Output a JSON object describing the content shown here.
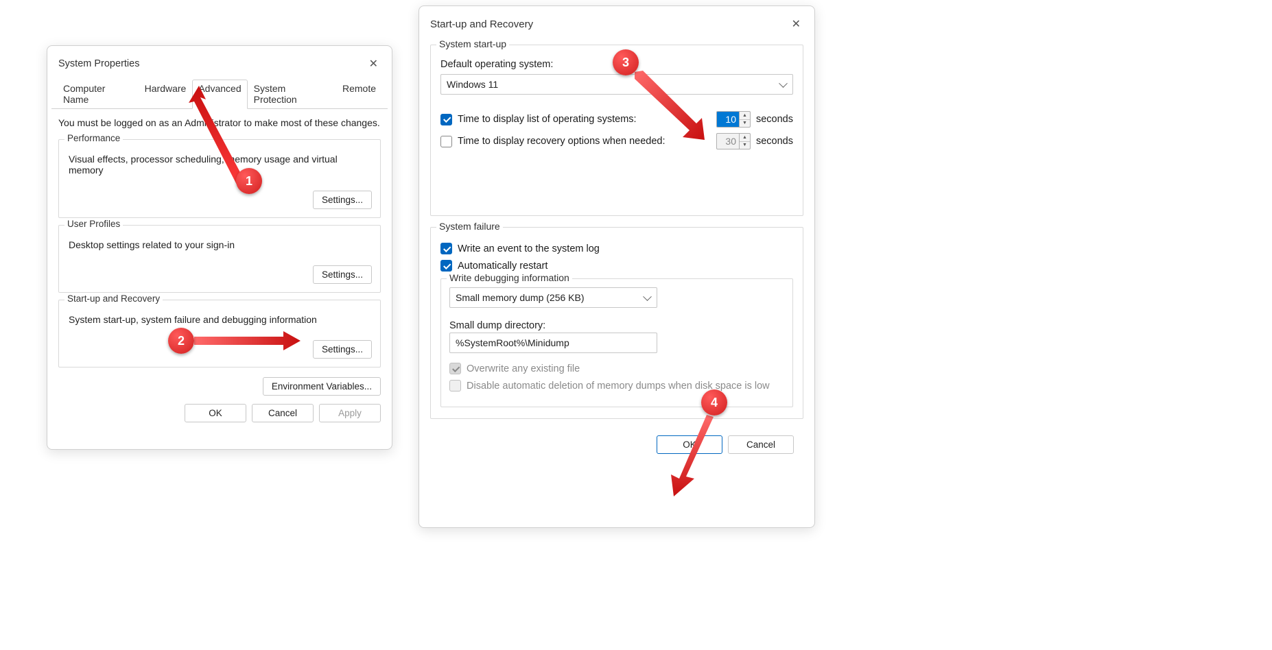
{
  "sysprop": {
    "title": "System Properties",
    "tabs": [
      "Computer Name",
      "Hardware",
      "Advanced",
      "System Protection",
      "Remote"
    ],
    "active_tab_index": 2,
    "intro": "You must be logged on as an Administrator to make most of these changes.",
    "performance": {
      "legend": "Performance",
      "desc": "Visual effects, processor scheduling, memory usage and virtual memory",
      "button": "Settings..."
    },
    "userprofiles": {
      "legend": "User Profiles",
      "desc": "Desktop settings related to your sign-in",
      "button": "Settings..."
    },
    "startup_recovery": {
      "legend": "Start-up and Recovery",
      "desc": "System start-up, system failure and debugging information",
      "button": "Settings..."
    },
    "envvars_button": "Environment Variables...",
    "ok": "OK",
    "cancel": "Cancel",
    "apply": "Apply"
  },
  "startup": {
    "title": "Start-up and Recovery",
    "system_startup": {
      "legend": "System start-up",
      "default_os_label": "Default operating system:",
      "default_os_value": "Windows 11",
      "time_list_label": "Time to display list of operating systems:",
      "time_list_checked": true,
      "time_list_value": "10",
      "time_recovery_label": "Time to display recovery options when needed:",
      "time_recovery_checked": false,
      "time_recovery_value": "30",
      "seconds": "seconds"
    },
    "system_failure": {
      "legend": "System failure",
      "write_event_label": "Write an event to the system log",
      "write_event_checked": true,
      "auto_restart_label": "Automatically restart",
      "auto_restart_checked": true,
      "debug_legend": "Write debugging information",
      "debug_select": "Small memory dump (256 KB)",
      "dump_dir_label": "Small dump directory:",
      "dump_dir_value": "%SystemRoot%\\Minidump",
      "overwrite_label": "Overwrite any existing file",
      "disable_auto_delete_label": "Disable automatic deletion of memory dumps when disk space is low"
    },
    "ok": "OK",
    "cancel": "Cancel"
  },
  "callouts": {
    "1": "1",
    "2": "2",
    "3": "3",
    "4": "4"
  }
}
